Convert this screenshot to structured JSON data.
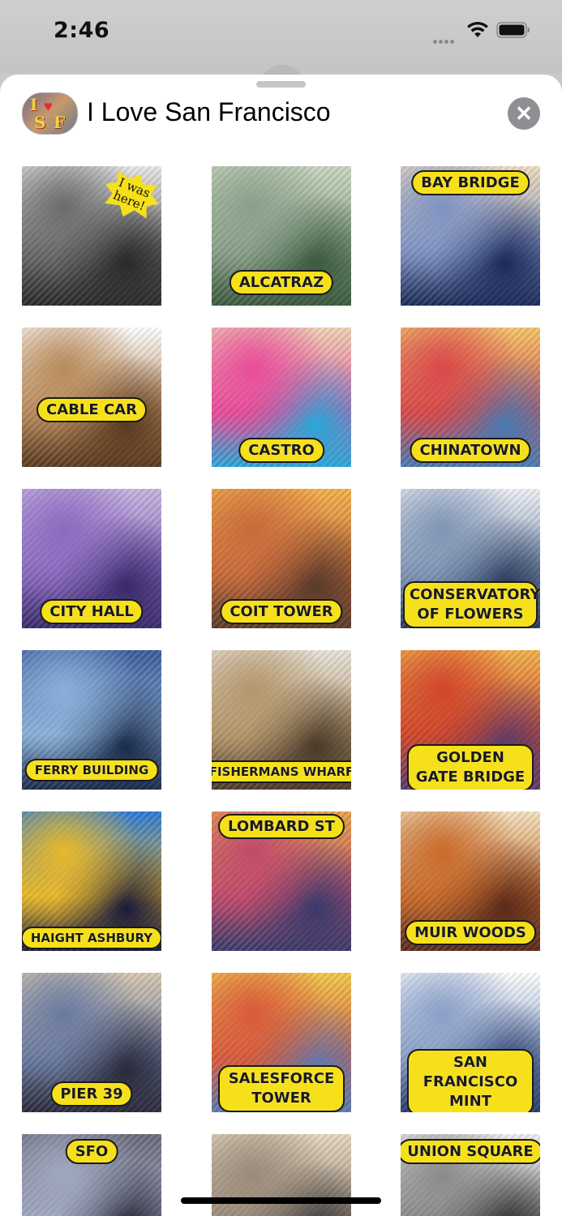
{
  "status_bar": {
    "time": "2:46"
  },
  "sheet": {
    "title": "I Love San Francisco",
    "icon_letters": [
      "I",
      "S",
      "F"
    ]
  },
  "stickers": [
    {
      "label": "",
      "badge": "I was here!",
      "theme": [
        "#e9e9e9",
        "#6b6b6b",
        "#2a2a2a"
      ]
    },
    {
      "label": "ALCATRAZ",
      "theme": [
        "#c9d7c0",
        "#8aa08a",
        "#3b5a3e"
      ]
    },
    {
      "label": "BAY BRIDGE",
      "theme": [
        "#f0dcc0",
        "#7f93c2",
        "#1c2a5a"
      ]
    },
    {
      "label": "CABLE CAR",
      "theme": [
        "#ffffff",
        "#b98a5a",
        "#5a3a20"
      ]
    },
    {
      "label": "CASTRO",
      "theme": [
        "#f0d5b5",
        "#e84c9a",
        "#2aa7d8"
      ]
    },
    {
      "label": "CHINATOWN",
      "theme": [
        "#f4c66a",
        "#d8484a",
        "#4a7ab0"
      ]
    },
    {
      "label": "CITY HALL",
      "theme": [
        "#c9b3e0",
        "#8a6ac0",
        "#3a2a6a"
      ]
    },
    {
      "label": "COIT TOWER",
      "theme": [
        "#f5b04a",
        "#c86a3a",
        "#5a3a2a"
      ]
    },
    {
      "label": "CONSERVATORY OF FLOWERS",
      "theme": [
        "#eef0f5",
        "#7f95b5",
        "#2a3a5a"
      ]
    },
    {
      "label": "FERRY BUILDING",
      "theme": [
        "#3a5a9a",
        "#8ab0d8",
        "#1a2a4a"
      ]
    },
    {
      "label": "FISHERMANS WHARF",
      "theme": [
        "#e8e4dc",
        "#b4966a",
        "#4a3a2a"
      ]
    },
    {
      "label": "GOLDEN GATE BRIDGE",
      "theme": [
        "#f2b24a",
        "#d0452a",
        "#5a3a6a"
      ]
    },
    {
      "label": "HAIGHT ASHBURY",
      "theme": [
        "#2a7ad8",
        "#e8b82a",
        "#1a1a3a"
      ]
    },
    {
      "label": "LOMBARD ST",
      "theme": [
        "#e8a24a",
        "#c04a6a",
        "#3a3a6a"
      ]
    },
    {
      "label": "MUIR WOODS",
      "theme": [
        "#f4e2c0",
        "#c86a2a",
        "#5a2a1a"
      ]
    },
    {
      "label": "PIER 39",
      "theme": [
        "#d8c8b0",
        "#6a7aa0",
        "#2a2a3a"
      ]
    },
    {
      "label": "SALESFORCE TOWER",
      "theme": [
        "#f2c94a",
        "#d85a3a",
        "#5a7ab0"
      ]
    },
    {
      "label": "SAN FRANCISCO MINT",
      "theme": [
        "#ffffff",
        "#8aa0c8",
        "#2a3a6a"
      ]
    },
    {
      "label": "SFO",
      "theme": [
        "#6a6a7a",
        "#a0a8c0",
        "#1a1a2a"
      ]
    },
    {
      "label": "",
      "theme": [
        "#e8d8c0",
        "#9a8a7a",
        "#3a3a3a"
      ]
    },
    {
      "label": "UNION SQUARE",
      "theme": [
        "#eeeeee",
        "#8a8a8a",
        "#2a2a2a"
      ]
    }
  ]
}
